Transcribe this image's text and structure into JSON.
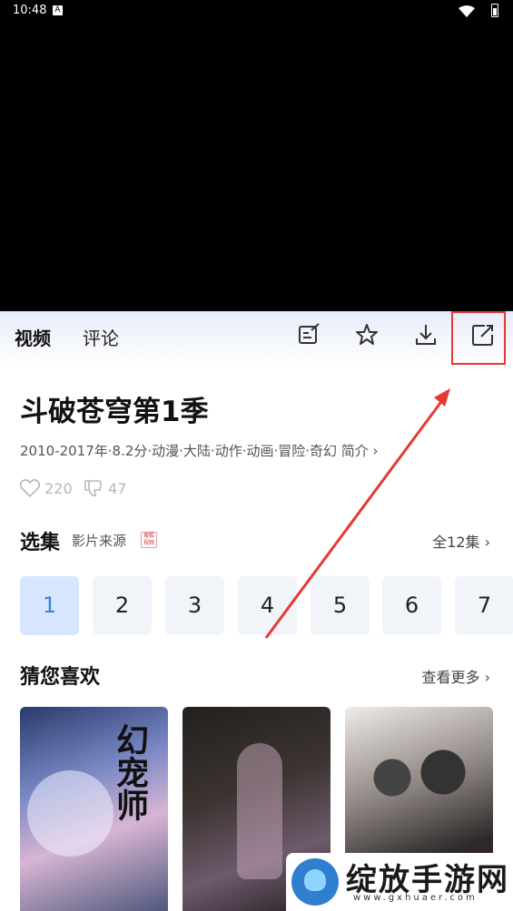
{
  "status_bar": {
    "time": "10:48",
    "a_glyph": "A"
  },
  "tabs": [
    {
      "label": "视频"
    },
    {
      "label": "评论"
    }
  ],
  "toolbar": {
    "icons": [
      "edit-icon",
      "star-icon",
      "download-icon",
      "share-icon"
    ]
  },
  "show": {
    "title": "斗破苍穹第1季",
    "meta": "2010-2017年·8.2分·动漫·大陆·动作·动画·冒险·奇幻 简介",
    "likes": "220",
    "dislikes": "47"
  },
  "episodes_section": {
    "title": "选集",
    "source_label": "影片来源",
    "badge": "搜狐\n视频",
    "all_label": "全12集",
    "episodes": [
      "1",
      "2",
      "3",
      "4",
      "5",
      "6",
      "7"
    ],
    "selected_index": 0
  },
  "recommend_section": {
    "title": "猜您喜欢",
    "more_label": "查看更多",
    "poster_1_text": "幻宠师"
  },
  "watermark": {
    "title": "绽放手游网",
    "url": "www.gxhuaer.com"
  },
  "colors": {
    "accent": "#3b7fe4",
    "highlight_box": "#e53935",
    "selected_episode_bg": "#d6e6ff"
  }
}
